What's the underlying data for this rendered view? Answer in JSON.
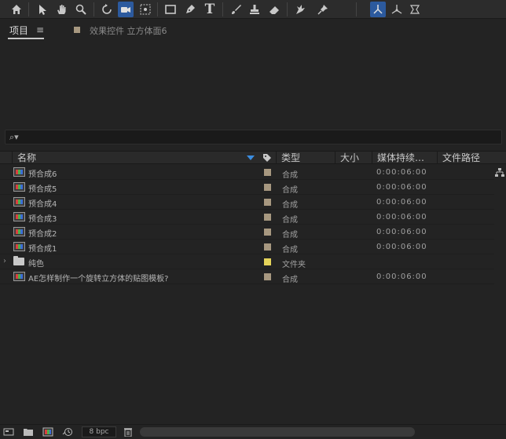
{
  "toolbar": {
    "tools": [
      "home-icon",
      "selection-tool-icon",
      "hand-tool-icon",
      "zoom-tool-icon",
      "rotate-tool-icon",
      "camera-tool-icon",
      "pan-behind-tool-icon",
      "rectangle-tool-icon",
      "pen-tool-icon",
      "type-tool-icon",
      "brush-tool-icon",
      "clone-stamp-tool-icon",
      "eraser-tool-icon",
      "roto-brush-tool-icon",
      "puppet-pin-tool-icon",
      "local-axis-icon",
      "world-axis-icon",
      "view-axis-icon"
    ],
    "type_glyph": "T",
    "accent_color": "#2c5a9e"
  },
  "tabs": {
    "project_label": "项目",
    "menu_glyph": "≡",
    "effects_label": "效果控件 立方体面6"
  },
  "search": {
    "icon_glyph": "⌕▾",
    "value": "",
    "placeholder": ""
  },
  "table": {
    "columns": {
      "name": "名称",
      "type": "类型",
      "size": "大小",
      "duration": "媒体持续…",
      "path": "文件路径"
    },
    "rows": [
      {
        "name": "预合成6",
        "kind": "comp",
        "label_color": "#a79880",
        "type": "合成",
        "duration": "0:00:06:00"
      },
      {
        "name": "预合成5",
        "kind": "comp",
        "label_color": "#a79880",
        "type": "合成",
        "duration": "0:00:06:00"
      },
      {
        "name": "预合成4",
        "kind": "comp",
        "label_color": "#a79880",
        "type": "合成",
        "duration": "0:00:06:00"
      },
      {
        "name": "预合成3",
        "kind": "comp",
        "label_color": "#a79880",
        "type": "合成",
        "duration": "0:00:06:00"
      },
      {
        "name": "预合成2",
        "kind": "comp",
        "label_color": "#a79880",
        "type": "合成",
        "duration": "0:00:06:00"
      },
      {
        "name": "预合成1",
        "kind": "comp",
        "label_color": "#a79880",
        "type": "合成",
        "duration": "0:00:06:00"
      },
      {
        "name": "纯色",
        "kind": "folder",
        "label_color": "#e5d45a",
        "type": "文件夹",
        "duration": ""
      },
      {
        "name": "AE怎样制作一个旋转立方体的贴图模板?",
        "kind": "comp",
        "label_color": "#a79880",
        "type": "合成",
        "duration": "0:00:06:00"
      }
    ]
  },
  "bottombar": {
    "bpc_label": "8 bpc"
  }
}
